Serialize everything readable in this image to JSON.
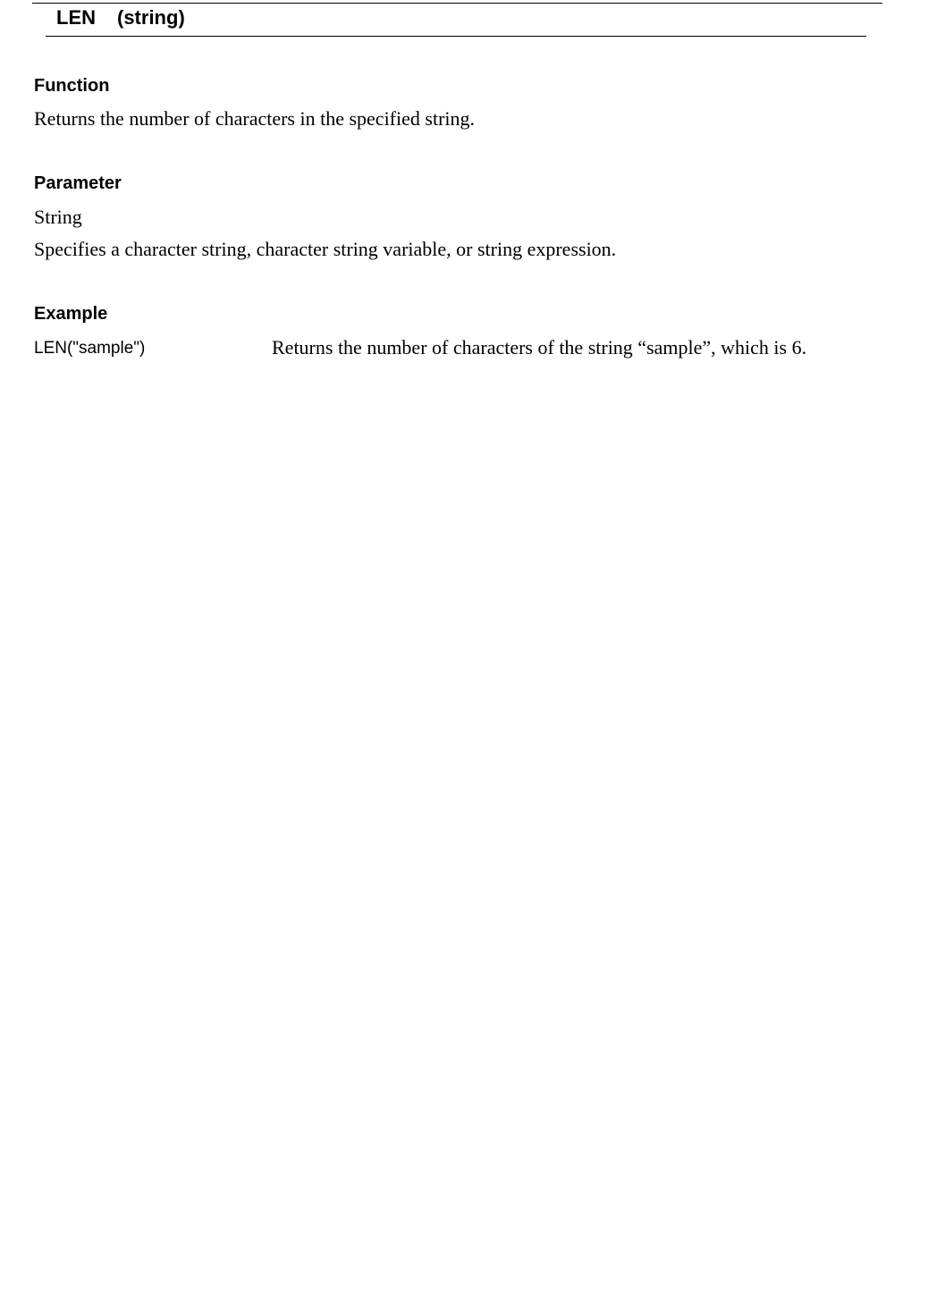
{
  "heading": {
    "keyword": "LEN",
    "syntax": "(string)"
  },
  "sections": {
    "function": {
      "label": "Function",
      "text": "Returns the number of characters in the specified string."
    },
    "parameter": {
      "label": "Parameter",
      "name": "String",
      "description": "Specifies a character string, character string variable, or string expression."
    },
    "example": {
      "label": "Example",
      "code": "LEN(\"sample\")",
      "description": "Returns the number of characters of the string “sample”, which is 6."
    }
  }
}
